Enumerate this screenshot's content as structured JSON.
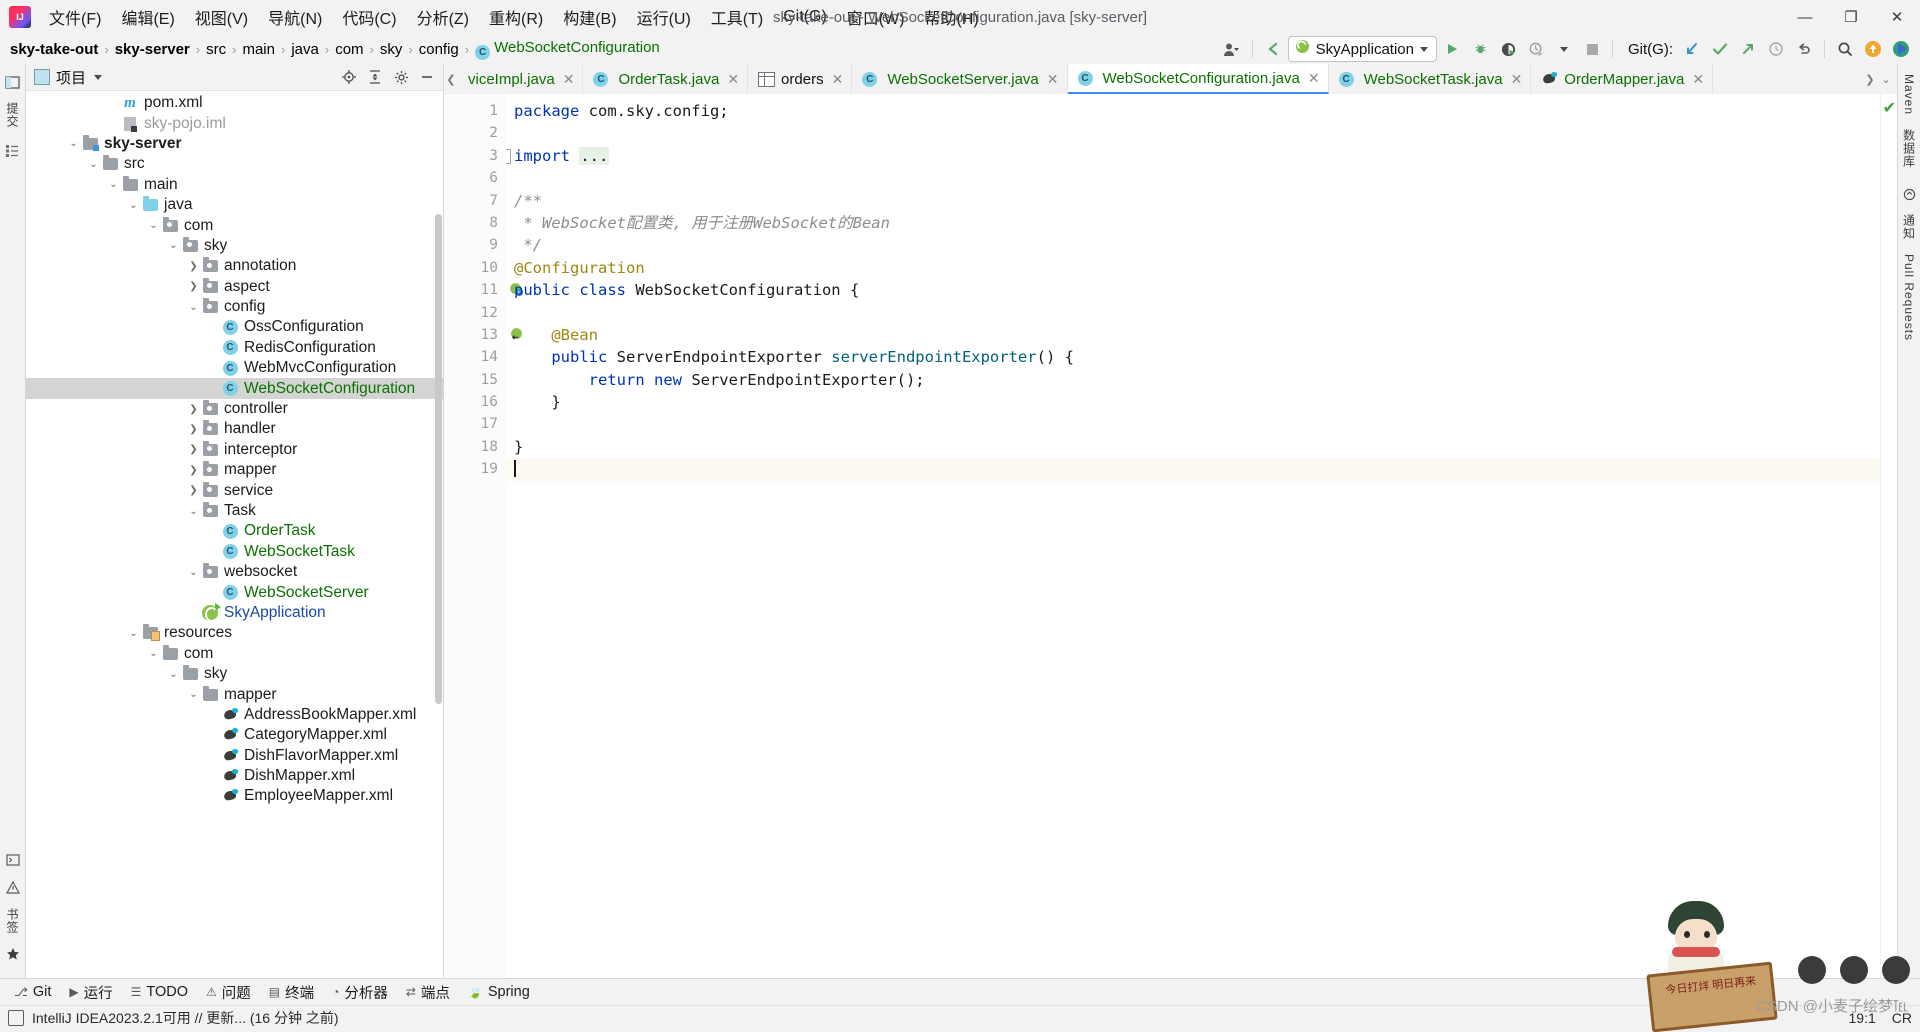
{
  "window": {
    "title": "sky-take-out - WebSocketConfiguration.java [sky-server]",
    "minimize": "—",
    "maximize": "❐",
    "close": "✕"
  },
  "menubar": {
    "logo": "intellij-idea-logo",
    "items": [
      {
        "label": "文件(F)"
      },
      {
        "label": "编辑(E)"
      },
      {
        "label": "视图(V)"
      },
      {
        "label": "导航(N)"
      },
      {
        "label": "代码(C)"
      },
      {
        "label": "分析(Z)"
      },
      {
        "label": "重构(R)"
      },
      {
        "label": "构建(B)"
      },
      {
        "label": "运行(U)"
      },
      {
        "label": "工具(T)"
      },
      {
        "label": "Git(G)"
      },
      {
        "label": "窗口(W)"
      },
      {
        "label": "帮助(H)"
      }
    ]
  },
  "navbar": {
    "breadcrumbs": [
      "sky-take-out",
      "sky-server",
      "src",
      "main",
      "java",
      "com",
      "sky",
      "config"
    ],
    "current_class": "WebSocketConfiguration",
    "class_badge": "C",
    "separator": "›",
    "run_config": "SkyApplication",
    "git_label": "Git(G):",
    "icons": {
      "account": "account-icon",
      "back_arrow": "navigate-back-icon",
      "run": "run-icon",
      "debug": "debug-icon",
      "run_coverage": "coverage-icon",
      "profiler": "profiler-icon",
      "stop": "stop-icon",
      "update_project": "update-project-icon",
      "commit": "commit-icon",
      "push": "push-icon",
      "history": "history-icon",
      "rollback": "rollback-icon",
      "search_everywhere": "search-icon",
      "ai_assistant": "ai-assistant-icon",
      "feedback": "feedback-icon"
    }
  },
  "project_panel": {
    "title": "项目",
    "icons": {
      "panel": "project-panel-icon",
      "locate": "scroll-from-source-icon",
      "collapse": "collapse-all-icon",
      "settings": "gear-icon",
      "hide": "hide-panel-icon"
    },
    "tree": [
      {
        "label": "pom.xml",
        "indent": 4,
        "arrow": "none",
        "icon": "maven-icon",
        "style": "plain"
      },
      {
        "label": "sky-pojo.iml",
        "indent": 4,
        "arrow": "none",
        "icon": "iml-icon",
        "style": "grey"
      },
      {
        "label": "sky-server",
        "indent": 2,
        "arrow": "down",
        "icon": "module-folder-icon",
        "style": "bold"
      },
      {
        "label": "src",
        "indent": 3,
        "arrow": "down",
        "icon": "folder-icon",
        "style": "plain"
      },
      {
        "label": "main",
        "indent": 4,
        "arrow": "down",
        "icon": "folder-icon",
        "style": "plain"
      },
      {
        "label": "java",
        "indent": 5,
        "arrow": "down",
        "icon": "source-folder-icon",
        "style": "plain"
      },
      {
        "label": "com",
        "indent": 6,
        "arrow": "down",
        "icon": "package-icon",
        "style": "plain"
      },
      {
        "label": "sky",
        "indent": 7,
        "arrow": "down",
        "icon": "package-icon",
        "style": "plain"
      },
      {
        "label": "annotation",
        "indent": 8,
        "arrow": "right",
        "icon": "package-icon",
        "style": "plain"
      },
      {
        "label": "aspect",
        "indent": 8,
        "arrow": "right",
        "icon": "package-icon",
        "style": "plain"
      },
      {
        "label": "config",
        "indent": 8,
        "arrow": "down",
        "icon": "package-icon",
        "style": "plain"
      },
      {
        "label": "OssConfiguration",
        "indent": 9,
        "arrow": "none",
        "icon": "java-class-icon",
        "style": "plain"
      },
      {
        "label": "RedisConfiguration",
        "indent": 9,
        "arrow": "none",
        "icon": "java-class-icon",
        "style": "plain"
      },
      {
        "label": "WebMvcConfiguration",
        "indent": 9,
        "arrow": "none",
        "icon": "java-class-icon",
        "style": "plain"
      },
      {
        "label": "WebSocketConfiguration",
        "indent": 9,
        "arrow": "none",
        "icon": "java-class-icon",
        "style": "green",
        "selected": true
      },
      {
        "label": "controller",
        "indent": 8,
        "arrow": "right",
        "icon": "package-icon",
        "style": "plain"
      },
      {
        "label": "handler",
        "indent": 8,
        "arrow": "right",
        "icon": "package-icon",
        "style": "plain"
      },
      {
        "label": "interceptor",
        "indent": 8,
        "arrow": "right",
        "icon": "package-icon",
        "style": "plain"
      },
      {
        "label": "mapper",
        "indent": 8,
        "arrow": "right",
        "icon": "package-icon",
        "style": "plain"
      },
      {
        "label": "service",
        "indent": 8,
        "arrow": "right",
        "icon": "package-icon",
        "style": "plain"
      },
      {
        "label": "Task",
        "indent": 8,
        "arrow": "down",
        "icon": "package-icon",
        "style": "plain"
      },
      {
        "label": "OrderTask",
        "indent": 9,
        "arrow": "none",
        "icon": "java-class-icon",
        "style": "green"
      },
      {
        "label": "WebSocketTask",
        "indent": 9,
        "arrow": "none",
        "icon": "java-class-icon",
        "style": "green"
      },
      {
        "label": "websocket",
        "indent": 8,
        "arrow": "down",
        "icon": "package-icon",
        "style": "plain"
      },
      {
        "label": "WebSocketServer",
        "indent": 9,
        "arrow": "none",
        "icon": "java-class-icon",
        "style": "green"
      },
      {
        "label": "SkyApplication",
        "indent": 8,
        "arrow": "none",
        "icon": "spring-boot-class-icon",
        "style": "blue"
      },
      {
        "label": "resources",
        "indent": 5,
        "arrow": "down",
        "icon": "resources-folder-icon",
        "style": "plain"
      },
      {
        "label": "com",
        "indent": 6,
        "arrow": "down",
        "icon": "folder-icon",
        "style": "plain"
      },
      {
        "label": "sky",
        "indent": 7,
        "arrow": "down",
        "icon": "folder-icon",
        "style": "plain"
      },
      {
        "label": "mapper",
        "indent": 8,
        "arrow": "down",
        "icon": "folder-icon",
        "style": "plain"
      },
      {
        "label": "AddressBookMapper.xml",
        "indent": 9,
        "arrow": "none",
        "icon": "xml-icon",
        "style": "plain"
      },
      {
        "label": "CategoryMapper.xml",
        "indent": 9,
        "arrow": "none",
        "icon": "xml-icon",
        "style": "plain"
      },
      {
        "label": "DishFlavorMapper.xml",
        "indent": 9,
        "arrow": "none",
        "icon": "xml-icon",
        "style": "plain"
      },
      {
        "label": "DishMapper.xml",
        "indent": 9,
        "arrow": "none",
        "icon": "xml-icon",
        "style": "plain"
      },
      {
        "label": "EmployeeMapper.xml",
        "indent": 9,
        "arrow": "none",
        "icon": "xml-icon",
        "style": "plain"
      }
    ]
  },
  "editor": {
    "tabs": [
      {
        "label": "viceImpl.java",
        "icon": "java-class-icon",
        "color": "green",
        "active": false,
        "truncated": true
      },
      {
        "label": "OrderTask.java",
        "icon": "java-class-icon",
        "color": "green",
        "active": false
      },
      {
        "label": "orders",
        "icon": "database-table-icon",
        "color": "plain",
        "active": false
      },
      {
        "label": "WebSocketServer.java",
        "icon": "java-class-icon",
        "color": "green",
        "active": false
      },
      {
        "label": "WebSocketConfiguration.java",
        "icon": "java-class-icon",
        "color": "green",
        "active": true
      },
      {
        "label": "WebSocketTask.java",
        "icon": "java-class-icon",
        "color": "green",
        "active": false
      },
      {
        "label": "OrderMapper.java",
        "icon": "xml-icon",
        "color": "green",
        "active": false
      }
    ],
    "close_label": "✕",
    "line_numbers": [
      "1",
      "2",
      "3",
      "6",
      "7",
      "8",
      "9",
      "10",
      "11",
      "12",
      "13",
      "14",
      "15",
      "16",
      "17",
      "18",
      "19"
    ],
    "code_lines": [
      {
        "n": "1",
        "tokens": [
          {
            "t": "package ",
            "c": "kw"
          },
          {
            "t": "com.sky.config;",
            "c": "pl"
          }
        ]
      },
      {
        "n": "2",
        "tokens": []
      },
      {
        "n": "3",
        "tokens": [
          {
            "t": "import ",
            "c": "kw"
          },
          {
            "t": "...",
            "c": "impdots"
          }
        ],
        "fold": "plus"
      },
      {
        "n": "6",
        "tokens": []
      },
      {
        "n": "7",
        "tokens": [
          {
            "t": "/**",
            "c": "cmt"
          }
        ],
        "fold": "top"
      },
      {
        "n": "8",
        "tokens": [
          {
            "t": " * WebSocket配置类, 用于注册WebSocket的Bean",
            "c": "cmt"
          }
        ]
      },
      {
        "n": "9",
        "tokens": [
          {
            "t": " */",
            "c": "cmt"
          }
        ],
        "fold": "bot"
      },
      {
        "n": "10",
        "tokens": [
          {
            "t": "@Configuration",
            "c": "ann"
          }
        ]
      },
      {
        "n": "11",
        "tokens": [
          {
            "t": "public ",
            "c": "kw"
          },
          {
            "t": "class ",
            "c": "kw"
          },
          {
            "t": "WebSocketConfiguration {",
            "c": "pl"
          }
        ],
        "gutter_mark": "spring-bean-icon"
      },
      {
        "n": "12",
        "tokens": []
      },
      {
        "n": "13",
        "tokens": [
          {
            "t": "    @Bean",
            "c": "ann"
          }
        ],
        "gutter_mark": "bean-nav-icon"
      },
      {
        "n": "14",
        "tokens": [
          {
            "t": "    public ",
            "c": "kw"
          },
          {
            "t": "ServerEndpointExporter ",
            "c": "pl"
          },
          {
            "t": "serverEndpointExporter",
            "c": "mth"
          },
          {
            "t": "() {",
            "c": "pl"
          }
        ],
        "fold": "top"
      },
      {
        "n": "15",
        "tokens": [
          {
            "t": "        return ",
            "c": "kw"
          },
          {
            "t": "new ",
            "c": "kw"
          },
          {
            "t": "ServerEndpointExporter();",
            "c": "pl"
          }
        ]
      },
      {
        "n": "16",
        "tokens": [
          {
            "t": "    }",
            "c": "pl"
          }
        ],
        "fold": "bot"
      },
      {
        "n": "17",
        "tokens": []
      },
      {
        "n": "18",
        "tokens": [
          {
            "t": "}",
            "c": "pl"
          }
        ]
      },
      {
        "n": "19",
        "tokens": [],
        "caret": true,
        "current": true
      }
    ],
    "inspection_status": "✔"
  },
  "right_rail": {
    "items": [
      "Maven",
      "数据库",
      "通知",
      "Pull Requests"
    ]
  },
  "left_rail": {
    "items": [
      "项目",
      "提交",
      "结构",
      "书签"
    ]
  },
  "bottom_tools": [
    {
      "label": "Git",
      "icon": "git-icon"
    },
    {
      "label": "运行",
      "icon": "run-icon"
    },
    {
      "label": "TODO",
      "icon": "todo-icon"
    },
    {
      "label": "问题",
      "icon": "problems-icon"
    },
    {
      "label": "终端",
      "icon": "terminal-icon"
    },
    {
      "label": "分析器",
      "icon": "profiler-icon"
    },
    {
      "label": "端点",
      "icon": "endpoints-icon"
    },
    {
      "label": "Spring",
      "icon": "spring-icon"
    }
  ],
  "statusbar": {
    "message": "IntelliJ IDEA2023.2.1可用 // 更新... (16 分钟 之前)",
    "caret_position": "19:1",
    "line_separator": "CR",
    "icon": "event-log-icon"
  },
  "overlay": {
    "signboard_text": "今日打烊\n明日再来",
    "watermark": "CSDN @小麦子绘梦℡"
  },
  "colors": {
    "accent_blue": "#3f8df2",
    "class_green": "#0a7200",
    "keyword_blue": "#0033b3",
    "annotation_yellow": "#9e880d",
    "comment_grey": "#8c8c8c",
    "selection_grey": "#d4d4d4",
    "toolbar_bg": "#f2f2f2",
    "editor_bg": "#ffffff"
  }
}
